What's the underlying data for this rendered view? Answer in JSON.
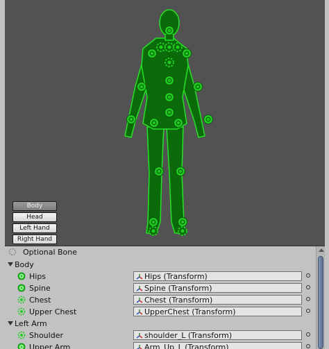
{
  "part_buttons": [
    {
      "label": "Body",
      "active": true
    },
    {
      "label": "Head",
      "active": false
    },
    {
      "label": "Left Hand",
      "active": false
    },
    {
      "label": "Right Hand",
      "active": false
    }
  ],
  "legend": {
    "optional_bone_label": "Optional Bone"
  },
  "groups": [
    {
      "label": "Body",
      "expanded": true,
      "bones": [
        {
          "label": "Hips",
          "value": "Hips (Transform)",
          "required": true
        },
        {
          "label": "Spine",
          "value": "Spine (Transform)",
          "required": true
        },
        {
          "label": "Chest",
          "value": "Chest (Transform)",
          "required": false
        },
        {
          "label": "Upper Chest",
          "value": "UpperChest (Transform)",
          "required": false
        }
      ]
    },
    {
      "label": "Left Arm",
      "expanded": true,
      "bones": [
        {
          "label": "Shoulder",
          "value": "shoulder_L (Transform)",
          "required": false
        },
        {
          "label": "Upper Arm",
          "value": "Arm_Up_L (Transform)",
          "required": true
        }
      ]
    }
  ],
  "colors": {
    "accent": "#22cc22",
    "figure_fill": "#0b6b0b",
    "figure_outline": "#25e025",
    "view_bg": "#525252",
    "panel_bg": "#c2c2c2"
  },
  "icons": {
    "bone_required": "solid-circle-icon",
    "bone_optional": "dashed-circle-icon",
    "transform": "transform-axes-icon",
    "picker": "object-picker-icon"
  }
}
